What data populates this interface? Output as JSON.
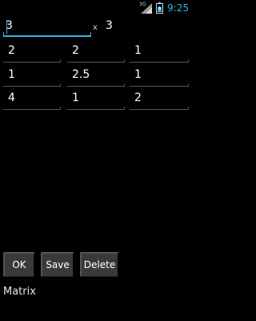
{
  "status_bar": {
    "network_type": "3G",
    "time": "9:25",
    "icons": [
      "signal-icon",
      "battery-icon"
    ]
  },
  "size": {
    "rows": "3",
    "times": "x",
    "cols": "3"
  },
  "matrix": [
    [
      "2",
      "2",
      "1"
    ],
    [
      "1",
      "2.5",
      "1"
    ],
    [
      "4",
      "1",
      "2"
    ]
  ],
  "buttons": {
    "ok": "OK",
    "save": "Save",
    "delete": "Delete"
  },
  "footer": {
    "label": "Matrix"
  },
  "colors": {
    "accent": "#33b5e5",
    "background": "#000000",
    "button": "#3a3a3a"
  }
}
